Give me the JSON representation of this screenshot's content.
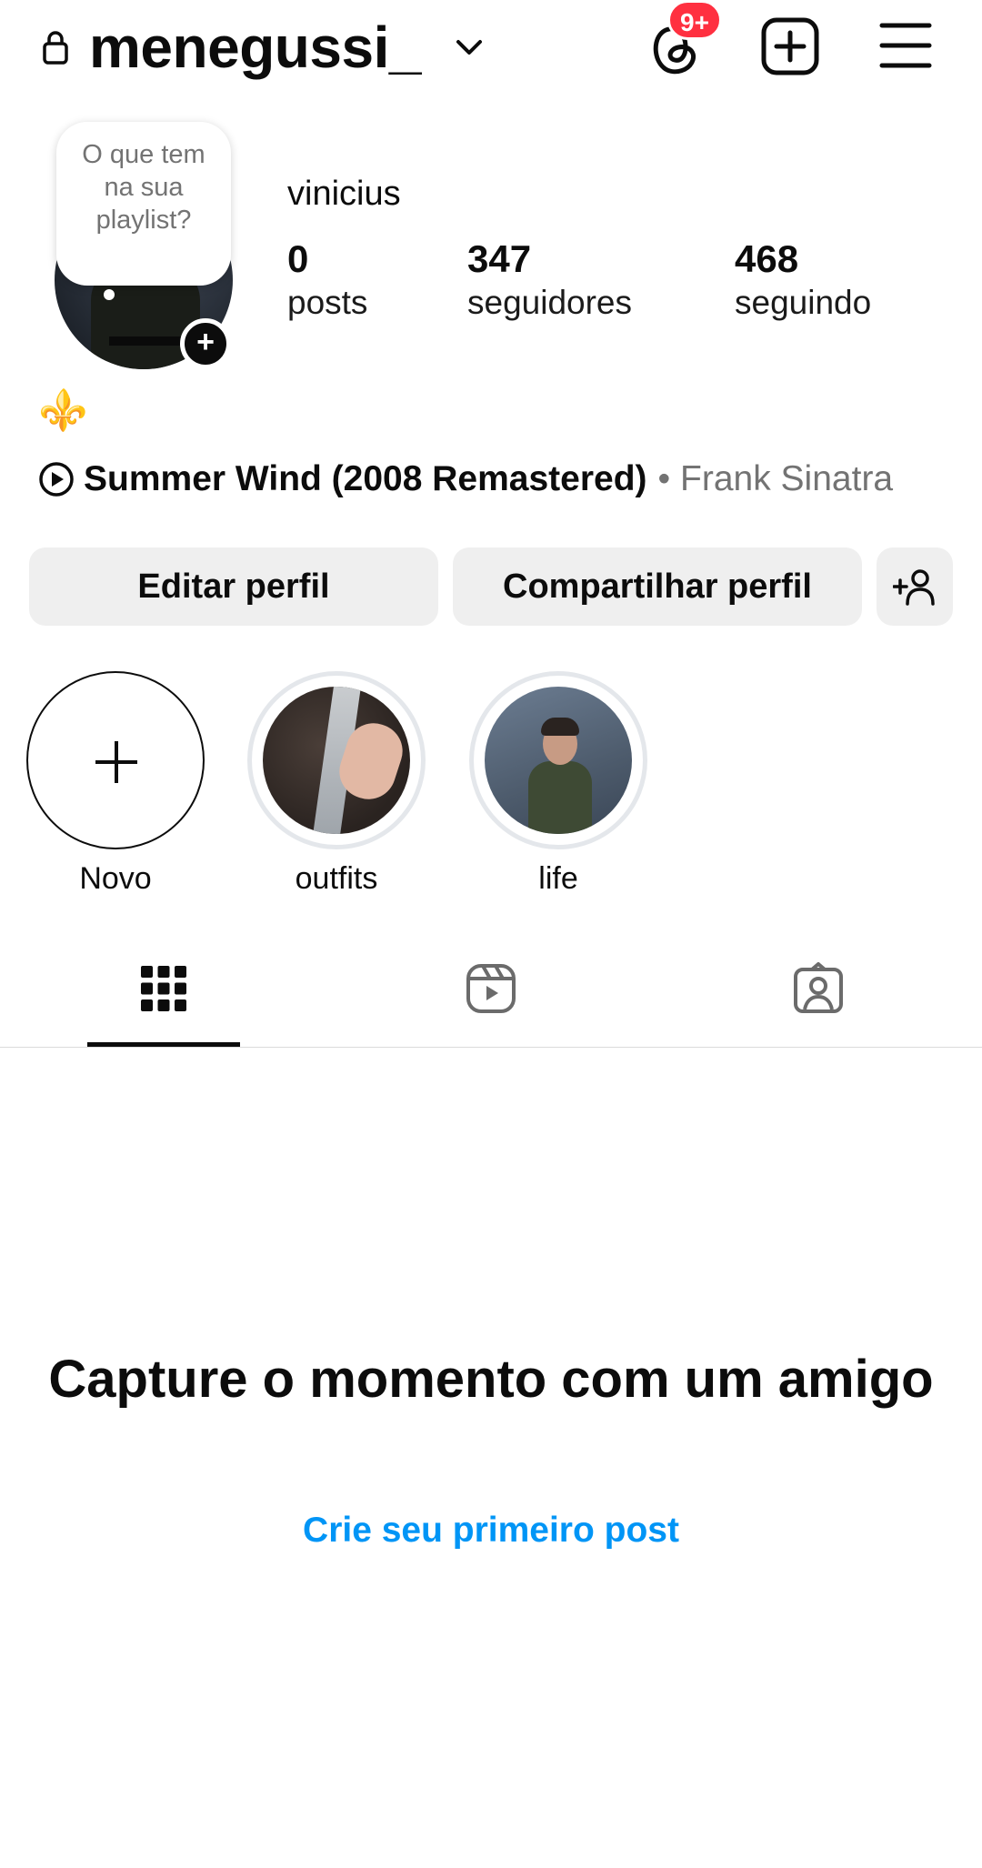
{
  "header": {
    "username": "menegussi_",
    "threads_badge": "9+"
  },
  "profile": {
    "note": "O que tem na sua playlist?",
    "display_name": "vinicius",
    "stats": [
      {
        "value": "0",
        "label": "posts"
      },
      {
        "value": "347",
        "label": "seguidores"
      },
      {
        "value": "468",
        "label": "seguindo"
      }
    ],
    "bio_emoji": "⚜️",
    "music": {
      "song": "Summer Wind (2008 Remastered)",
      "artist": "• Frank Sinatra"
    }
  },
  "actions": {
    "edit_label": "Editar perfil",
    "share_label": "Compartilhar perfil"
  },
  "highlights": [
    {
      "label": "Novo"
    },
    {
      "label": "outfits"
    },
    {
      "label": "life"
    }
  ],
  "tabs": [
    {
      "icon": "grid-icon",
      "selected": true
    },
    {
      "icon": "reels-icon",
      "selected": false
    },
    {
      "icon": "tagged-icon",
      "selected": false
    }
  ],
  "empty_state": {
    "title": "Capture o momento com um amigo",
    "link": "Crie seu primeiro post"
  },
  "colors": {
    "badge": "#ff3040",
    "link": "#0095f6",
    "button_bg": "#efefef"
  }
}
